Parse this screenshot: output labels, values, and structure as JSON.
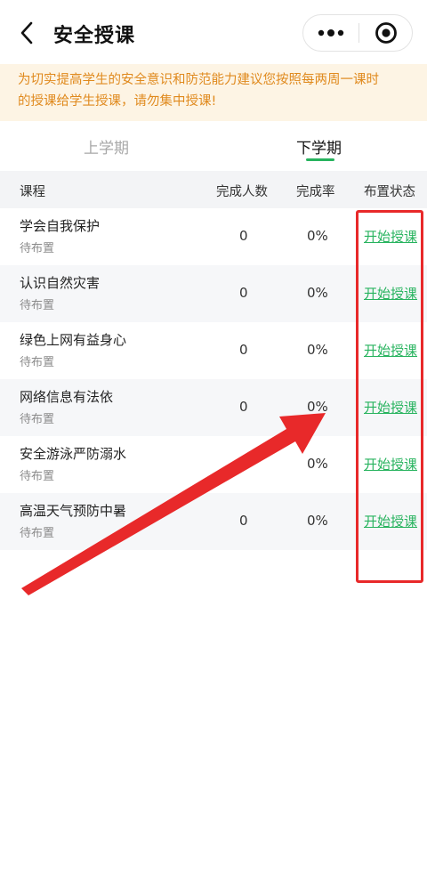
{
  "header": {
    "title": "安全授课",
    "back_icon": "chevron-left-icon",
    "more_icon": "more-dots-icon",
    "close_icon": "target-circle-icon"
  },
  "notice": {
    "line1": "为切实提高学生的安全意识和防范能力建议您按照每两周一课时",
    "line2": "的授课给学生授课，请勿集中授课!"
  },
  "tabs": [
    {
      "label": "上学期",
      "active": false
    },
    {
      "label": "下学期",
      "active": true
    }
  ],
  "table": {
    "headers": {
      "course": "课程",
      "count": "完成人数",
      "rate": "完成率",
      "status": "布置状态"
    },
    "rows": [
      {
        "course": "学会自我保护",
        "sub": "待布置",
        "count": "0",
        "rate": "0%",
        "action": "开始授课"
      },
      {
        "course": "认识自然灾害",
        "sub": "待布置",
        "count": "0",
        "rate": "0%",
        "action": "开始授课"
      },
      {
        "course": "绿色上网有益身心",
        "sub": "待布置",
        "count": "0",
        "rate": "0%",
        "action": "开始授课"
      },
      {
        "course": "网络信息有法依",
        "sub": "待布置",
        "count": "0",
        "rate": "0%",
        "action": "开始授课"
      },
      {
        "course": "安全游泳严防溺水",
        "sub": "待布置",
        "count": "0",
        "rate": "0%",
        "action": "开始授课"
      },
      {
        "course": "高温天气预防中暑",
        "sub": "待布置",
        "count": "0",
        "rate": "0%",
        "action": "开始授课"
      }
    ]
  },
  "colors": {
    "accent_green": "#27b35e",
    "notice_text": "#e08a1e",
    "notice_bg": "#fdf4e4",
    "annotation_red": "#e8292a"
  }
}
